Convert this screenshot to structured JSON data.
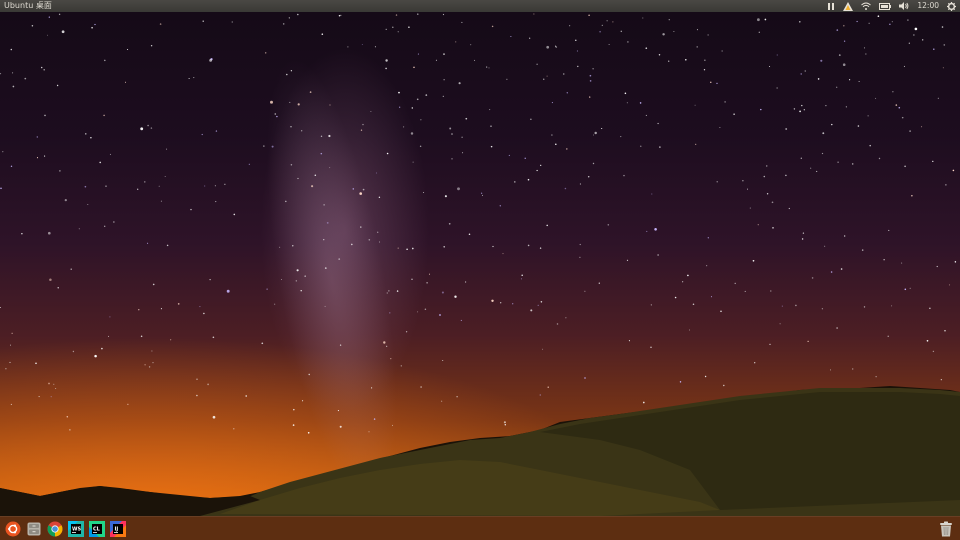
{
  "top_panel": {
    "title": "Ubuntu 桌面",
    "clock": "12:00",
    "indicators": [
      "keyboard-indicator-icon",
      "software-updater-icon",
      "wifi-icon",
      "battery-icon",
      "volume-icon",
      "gear-icon"
    ]
  },
  "launcher": {
    "items": [
      {
        "name": "dash-home",
        "icon": "ubuntu-logo-icon",
        "color": "#e95420"
      },
      {
        "name": "files",
        "icon": "file-cabinet-icon",
        "color": "#b7b3aa"
      },
      {
        "name": "chromium",
        "icon": "chromium-icon",
        "color": "#4a90d9"
      },
      {
        "name": "webstorm",
        "icon": "webstorm-icon",
        "label": "WS",
        "color": "#1fb6a8"
      },
      {
        "name": "clion",
        "icon": "clion-icon",
        "label": "CL",
        "color": "#21d789"
      },
      {
        "name": "intellij",
        "icon": "intellij-icon",
        "label": "IJ",
        "color": "#3b6ad8"
      }
    ],
    "trash_icon": "trash-icon"
  },
  "colors": {
    "panel": "#3d3c38",
    "launcher_tint": "#8a4019",
    "accent": "#e95420"
  }
}
